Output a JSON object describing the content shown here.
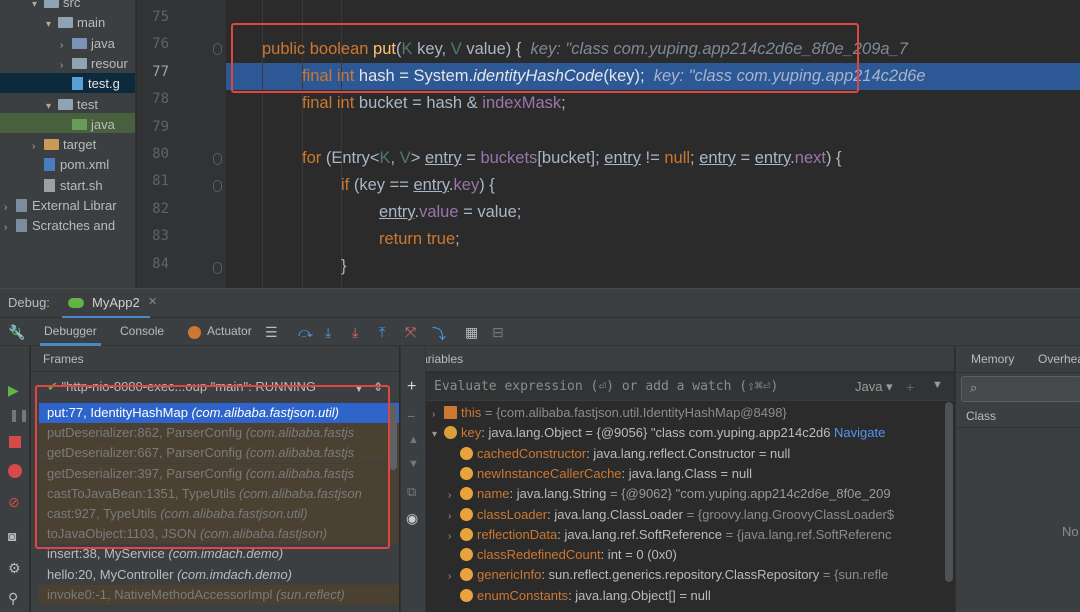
{
  "project_tree": {
    "items": [
      {
        "label": "src",
        "depth": 2,
        "arrow": "▾",
        "kind": "folder"
      },
      {
        "label": "main",
        "depth": 3,
        "arrow": "▾",
        "kind": "folder"
      },
      {
        "label": "java",
        "depth": 4,
        "arrow": "›",
        "kind": "folder-blue"
      },
      {
        "label": "resour",
        "depth": 4,
        "arrow": "›",
        "kind": "folder-res"
      },
      {
        "label": "test.g",
        "depth": 4,
        "arrow": "",
        "kind": "groovy-file",
        "selected": true
      },
      {
        "label": "test",
        "depth": 3,
        "arrow": "▾",
        "kind": "folder"
      },
      {
        "label": "java",
        "depth": 4,
        "arrow": "",
        "kind": "folder-green",
        "highlight": true
      },
      {
        "label": "target",
        "depth": 2,
        "arrow": "›",
        "kind": "folder-orange"
      },
      {
        "label": "pom.xml",
        "depth": 2,
        "arrow": "",
        "kind": "maven-file"
      },
      {
        "label": "start.sh",
        "depth": 2,
        "arrow": "",
        "kind": "shell-file"
      },
      {
        "label": "External Librar",
        "depth": 0,
        "arrow": "›",
        "kind": "library"
      },
      {
        "label": "Scratches and",
        "depth": 0,
        "arrow": "›",
        "kind": "scratch"
      }
    ]
  },
  "editor": {
    "line_numbers": [
      "75",
      "76",
      "77",
      "78",
      "79",
      "80",
      "81",
      "82",
      "83",
      "84"
    ],
    "lines": {
      "l76": {
        "kw1": "public",
        "kw2": "boolean",
        "fn": "put",
        "p1": "(",
        "t1": "K",
        "a1": " key, ",
        "t2": "V",
        "a2": " value) {",
        "hint": "key: \"class com.yuping.app214c2d6e_8f0e_209a_7"
      },
      "l77": {
        "kw1": "final",
        "kw2": "int",
        "a1": " hash = System.",
        "fn": "identityHashCode",
        "a2": "(key);",
        "hint": "key: \"class com.yuping.app214c2d6e"
      },
      "l78": {
        "kw1": "final",
        "kw2": "int",
        "a1": " bucket = hash & ",
        "fld": "indexMask",
        "a2": ";"
      },
      "l80": {
        "kw1": "for",
        "a1": " (Entry<",
        "t1": "K",
        "a2": ", ",
        "t2": "V",
        "a3": "> ",
        "e1": "entry",
        "a4": " = ",
        "f1": "buckets",
        "a5": "[bucket]; ",
        "e2": "entry",
        "a6": " != ",
        "kw2": "null",
        "a7": "; ",
        "e3": "entry",
        "a8": " = ",
        "e4": "entry",
        "a9": ".",
        "f2": "next",
        "a10": ") {"
      },
      "l81": {
        "kw1": "if",
        "a1": " (key == ",
        "e1": "entry",
        "a2": ".",
        "f1": "key",
        "a3": ") {"
      },
      "l82": {
        "e1": "entry",
        "a1": ".",
        "f1": "value",
        "a2": " = value;"
      },
      "l83": {
        "kw1": "return",
        "kw2": "true",
        "a1": ";"
      },
      "l84": {
        "a1": "}"
      }
    }
  },
  "debug": {
    "label": "Debug:",
    "config": "MyApp2",
    "tabs": [
      "Debugger",
      "Console",
      "Actuator"
    ]
  },
  "frames": {
    "title": "Frames",
    "thread": "\"http-nio-8080-exec...oup \"main\": RUNNING",
    "items": [
      {
        "method": "put:77, IdentityHashMap",
        "cls": "(com.alibaba.fastjson.util)",
        "style": "sel"
      },
      {
        "method": "putDeserializer:862, ParserConfig",
        "cls": "(com.alibaba.fastjs",
        "style": "dim"
      },
      {
        "method": "getDeserializer:667, ParserConfig",
        "cls": "(com.alibaba.fastjs",
        "style": "dim"
      },
      {
        "method": "getDeserializer:397, ParserConfig",
        "cls": "(com.alibaba.fastjs",
        "style": "dim"
      },
      {
        "method": "castToJavaBean:1351, TypeUtils",
        "cls": "(com.alibaba.fastjson",
        "style": "dim"
      },
      {
        "method": "cast:927, TypeUtils",
        "cls": "(com.alibaba.fastjson.util)",
        "style": "dim"
      },
      {
        "method": "toJavaObject:1103, JSON",
        "cls": "(com.alibaba.fastjson)",
        "style": "dim"
      },
      {
        "method": "insert:38, MyService",
        "cls": "(com.imdach.demo)",
        "style": "norm"
      },
      {
        "method": "hello:20, MyController",
        "cls": "(com.imdach.demo)",
        "style": "norm"
      },
      {
        "method": "invoke0:-1, NativeMethodAccessorImpl",
        "cls": "(sun.reflect)",
        "style": "dim"
      }
    ]
  },
  "variables": {
    "title": "Variables",
    "eval_placeholder": "Evaluate expression (⏎) or add a watch (⇧⌘⏎)",
    "lang": "Java",
    "items": [
      {
        "indent": 0,
        "tw": "›",
        "name": "this",
        "rest": "= {com.alibaba.fastjson.util.IdentityHashMap@8498}",
        "style": "ref",
        "icon": "field-lines"
      },
      {
        "indent": 0,
        "tw": "▾",
        "name": "key",
        "type": ": java.lang.Object",
        "rest": "= {@9056} \"class com.yuping.app214c2d6",
        "nav": "Navigate",
        "style": "val",
        "icon": "p"
      },
      {
        "indent": 1,
        "tw": "",
        "name": "cachedConstructor",
        "type": ": java.lang.reflect.Constructor",
        "rest": "= null",
        "style": "val",
        "icon": "f"
      },
      {
        "indent": 1,
        "tw": "",
        "name": "newInstanceCallerCache",
        "type": ": java.lang.Class",
        "rest": "= null",
        "style": "val",
        "icon": "f"
      },
      {
        "indent": 1,
        "tw": "›",
        "name": "name",
        "type": ": java.lang.String",
        "rest": "= {@9062} \"com.yuping.app214c2d6e_8f0e_209",
        "style": "str",
        "icon": "f"
      },
      {
        "indent": 1,
        "tw": "›",
        "name": "classLoader",
        "type": ": java.lang.ClassLoader",
        "rest": "= {groovy.lang.GroovyClassLoader$",
        "style": "ref",
        "icon": "f"
      },
      {
        "indent": 1,
        "tw": "›",
        "name": "reflectionData",
        "type": ": java.lang.ref.SoftReference",
        "rest": "= {java.lang.ref.SoftReferenc",
        "style": "ref",
        "icon": "f"
      },
      {
        "indent": 1,
        "tw": "",
        "name": "classRedefinedCount",
        "type": ": int",
        "rest": "= 0 (0x0)",
        "style": "val",
        "icon": "f"
      },
      {
        "indent": 1,
        "tw": "›",
        "name": "genericInfo",
        "type": ": sun.reflect.generics.repository.ClassRepository",
        "rest": "= {sun.refle",
        "style": "ref",
        "icon": "f"
      },
      {
        "indent": 1,
        "tw": "",
        "name": "enumConstants",
        "type": ": java.lang.Object[]",
        "rest": "= null",
        "style": "val",
        "icon": "f"
      }
    ]
  },
  "memory": {
    "tabs": [
      "Memory",
      "Overhea"
    ],
    "column": "Class",
    "empty": "No"
  },
  "colors": {
    "highlight_line": "#2d5896",
    "selected_frame": "#2f65ca",
    "annotation_red": "#e0463d",
    "keyword": "#cc7832",
    "function": "#ffc66d",
    "field": "#9876aa"
  }
}
